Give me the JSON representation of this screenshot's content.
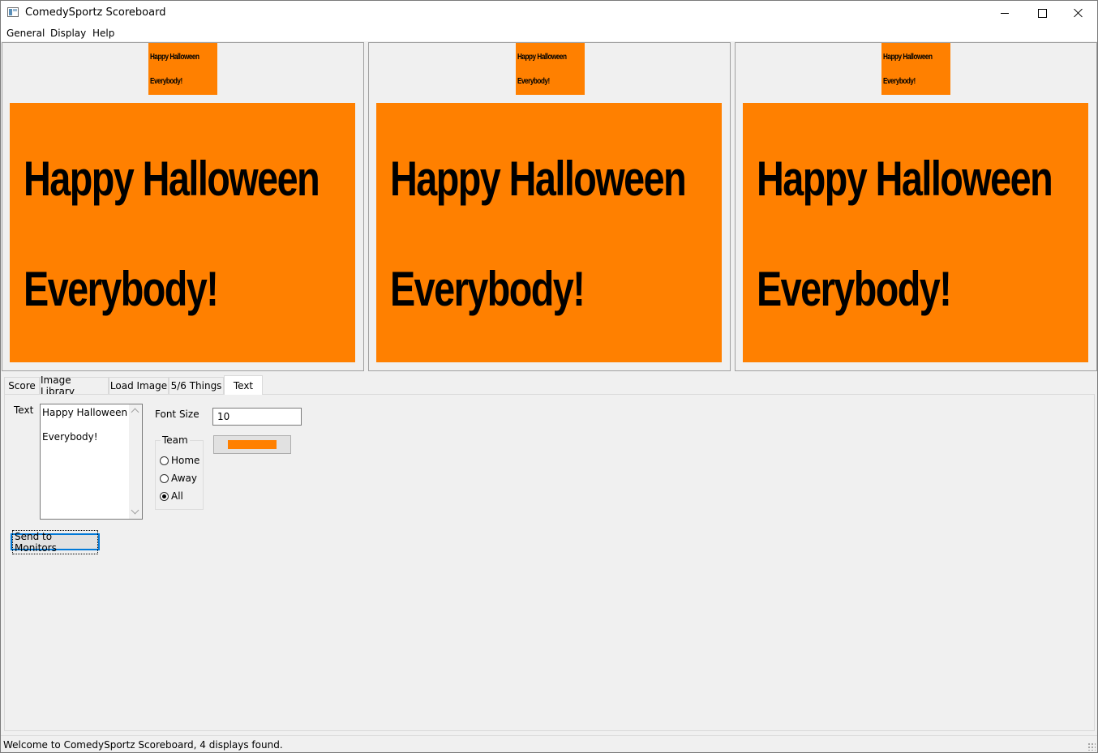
{
  "window": {
    "title": "ComedySportz Scoreboard",
    "icon": "app-window-icon"
  },
  "menu": [
    {
      "label": "General"
    },
    {
      "label": "Display"
    },
    {
      "label": "Help"
    }
  ],
  "monitors": [
    {
      "line1": "Happy Halloween",
      "line2": "Everybody!",
      "background": "#ff8000"
    },
    {
      "line1": "Happy Halloween",
      "line2": "Everybody!",
      "background": "#ff8000"
    },
    {
      "line1": "Happy Halloween",
      "line2": "Everybody!",
      "background": "#ff8000"
    }
  ],
  "tabs": [
    {
      "label": "Score"
    },
    {
      "label": "Image Library"
    },
    {
      "label": "Load Image"
    },
    {
      "label": "5/6 Things"
    },
    {
      "label": "Text",
      "active": true
    }
  ],
  "text_tab": {
    "text_label": "Text",
    "text_lines": [
      "Happy Halloween",
      "",
      "Everybody!"
    ],
    "font_size_label": "Font Size",
    "font_size_value": "10",
    "team_label": "Team",
    "team_options": [
      {
        "label": "Home",
        "checked": false
      },
      {
        "label": "Away",
        "checked": false
      },
      {
        "label": "All",
        "checked": true
      }
    ],
    "color": "#ff8000",
    "send_label": "Send to Monitors"
  },
  "status": {
    "text": "Welcome to ComedySportz Scoreboard, 4 displays found."
  }
}
